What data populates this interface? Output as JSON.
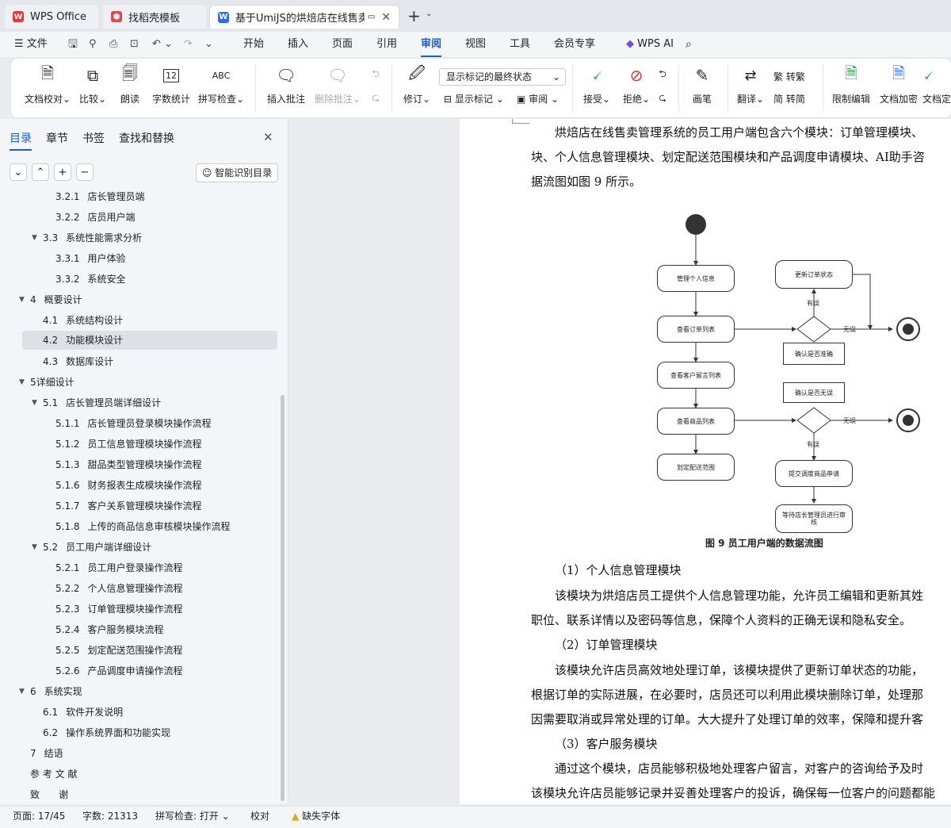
{
  "tabs": [
    {
      "label": "WPS Office"
    },
    {
      "label": "找稻壳模板"
    },
    {
      "label": "基于UmiJS的烘焙店在线售卖..."
    }
  ],
  "menu": {
    "file": "文件",
    "items": [
      "开始",
      "插入",
      "页面",
      "引用",
      "审阅",
      "视图",
      "工具",
      "会员专享"
    ],
    "wps_ai": "WPS AI"
  },
  "ribbon": {
    "doc_check": "文档校对",
    "compare": "比较",
    "read": "朗读",
    "word_count": "字数统计",
    "spell": "拼写检查",
    "insert_comment": "插入批注",
    "delete_comment": "删除批注",
    "revise": "修订",
    "display_state": "显示标记的最终状态",
    "show_marks": "显示标记",
    "review": "审阅",
    "accept": "接受",
    "reject": "拒绝",
    "pen": "画笔",
    "translate": "翻译",
    "to_trad": "转繁",
    "to_simp": "转简",
    "restrict": "限制编辑",
    "encrypt": "文档加密",
    "finalize": "文档定"
  },
  "sidebar": {
    "tabs": [
      "目录",
      "章节",
      "书签",
      "查找和替换"
    ],
    "smart_toc": "智能识别目录",
    "toc": [
      {
        "num": "3.2.1",
        "text": "店长管理员端"
      },
      {
        "num": "3.2.2",
        "text": "店员用户端"
      },
      {
        "num": "3.3",
        "text": "系统性能需求分析"
      },
      {
        "num": "3.3.1",
        "text": "用户体验"
      },
      {
        "num": "3.3.2",
        "text": "系统安全"
      },
      {
        "num": "4",
        "text": "概要设计"
      },
      {
        "num": "4.1",
        "text": "系统结构设计"
      },
      {
        "num": "4.2",
        "text": "功能模块设计"
      },
      {
        "num": "4.3",
        "text": "数据库设计"
      },
      {
        "num": "",
        "text": "5详细设计"
      },
      {
        "num": "5.1",
        "text": "店长管理员端详细设计"
      },
      {
        "num": "5.1.1",
        "text": "店长管理员登录模块操作流程"
      },
      {
        "num": "5.1.2",
        "text": "员工信息管理模块操作流程"
      },
      {
        "num": "5.1.3",
        "text": "甜品类型管理模块操作流程"
      },
      {
        "num": "5.1.6",
        "text": "财务报表生成模块操作流程"
      },
      {
        "num": "5.1.7",
        "text": "客户关系管理模块操作流程"
      },
      {
        "num": "5.1.8",
        "text": "上传的商品信息审核模块操作流程"
      },
      {
        "num": "5.2",
        "text": "员工用户端详细设计"
      },
      {
        "num": "5.2.1",
        "text": "员工用户登录操作流程"
      },
      {
        "num": "5.2.2",
        "text": "个人信息管理操作流程"
      },
      {
        "num": "5.2.3",
        "text": "订单管理模块操作流程"
      },
      {
        "num": "5.2.4",
        "text": "客户服务模块流程"
      },
      {
        "num": "5.2.5",
        "text": "划定配送范围操作流程"
      },
      {
        "num": "5.2.6",
        "text": "产品调度申请操作流程"
      },
      {
        "num": "6",
        "text": "系统实现"
      },
      {
        "num": "6.1",
        "text": "软件开发说明"
      },
      {
        "num": "6.2",
        "text": "操作系统界面和功能实现"
      },
      {
        "num": "7",
        "text": "结语"
      },
      {
        "num": "",
        "text": "参 考 文 献"
      },
      {
        "num": "",
        "text": "致　　谢"
      }
    ]
  },
  "doc": {
    "p1": [
      "烘焙店在线售卖管理系统的员工用户端包含六个模块：订单管理模块、",
      "块、个人信息管理模块、划定配送范围模块和产品调度申请模块、AI助手咨",
      "据流图如图 9 所示。"
    ],
    "figure_caption": "图 9  员工用户端的数据流图",
    "h1": "（1）个人信息管理模块",
    "p2": [
      "该模块为烘焙店员工提供个人信息管理功能，允许员工编辑和更新其姓",
      "职位、联系详情以及密码等信息，保障个人资料的正确无误和隐私安全。"
    ],
    "h2": "（2）订单管理模块",
    "p3": [
      "该模块允许店员高效地处理订单，该模块提供了更新订单状态的功能，",
      "根据订单的实际进展，在必要时，店员还可以利用此模块删除订单，处理那",
      "因需要取消或异常处理的订单。大大提升了处理订单的效率，保障和提升客"
    ],
    "h3": "（3）客户服务模块",
    "p4": [
      "通过这个模块，店员能够积极地处理客户留言，对客户的咨询给予及时",
      "该模块允许店员能够记录并妥善处理客户的投诉，确保每一位客户的问题都能"
    ]
  },
  "flow": {
    "manage_info": "管理个人信息",
    "view_orders": "查看订单列表",
    "view_messages": "查看客户留言列表",
    "view_products": "查看商品列表",
    "set_delivery": "划定配送范围",
    "update_status": "更新订单状态",
    "confirm_accurate": "确认是否准确",
    "confirm_error": "确认是否无误",
    "submit_request": "提交调度商品申请",
    "wait_review": "等待店长管理员进行审核",
    "has_error": "有误",
    "no_error": "无误"
  },
  "status": {
    "page": "页面: 17/45",
    "words": "字数: 21313",
    "spell": "拼写检查: 打开",
    "proof": "校对",
    "font_missing": "缺失字体"
  }
}
